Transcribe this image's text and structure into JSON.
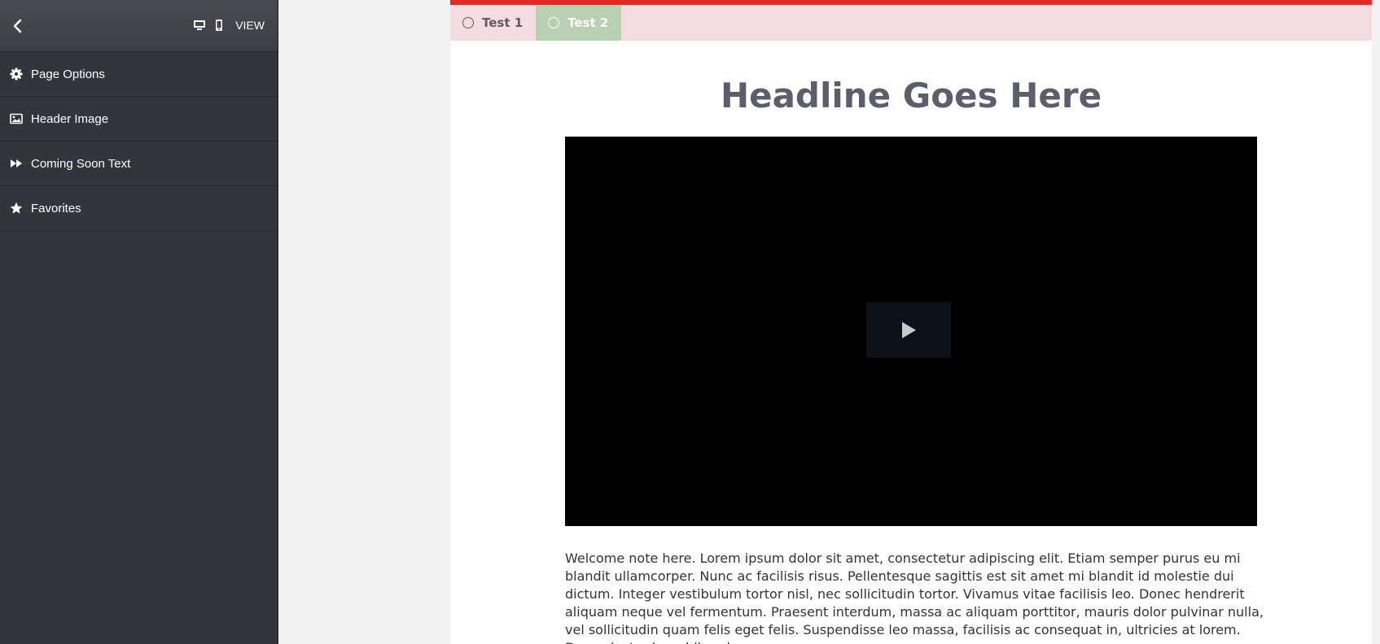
{
  "sidebar": {
    "view_label": "VIEW",
    "items": [
      {
        "label": "Page Options",
        "icon": "gear-icon"
      },
      {
        "label": "Header Image",
        "icon": "image-icon"
      },
      {
        "label": "Coming Soon Text",
        "icon": "fast-forward-icon"
      },
      {
        "label": "Favorites",
        "icon": "star-icon"
      }
    ]
  },
  "preview": {
    "tabs": [
      {
        "label": "Test 1",
        "active": false
      },
      {
        "label": "Test 2",
        "active": true
      }
    ],
    "headline": "Headline Goes Here",
    "welcome_text": "Welcome note here. Lorem ipsum dolor sit amet, consectetur adipiscing elit. Etiam semper purus eu mi blandit ullamcorper. Nunc ac facilisis risus. Pellentesque sagittis est sit amet mi blandit id molestie dui dictum. Integer vestibulum tortor nisl, nec sollicitudin tortor. Vivamus vitae facilisis leo. Donec hendrerit aliquam neque vel fermentum. Praesent interdum, massa ac aliquam porttitor, mauris dolor pulvinar nulla, vel sollicitudin quam felis eget felis. Suspendisse leo massa, facilisis ac consequat in, ultricies at lorem. Donec justo risus, bibendum nec"
  },
  "colors": {
    "accent_red": "#e8262a",
    "tab_bar_bg": "#f4dde0",
    "active_tab_bg": "#b9d0b3",
    "sidebar_bg": "#33343c",
    "headline": "#5d5e6b"
  }
}
